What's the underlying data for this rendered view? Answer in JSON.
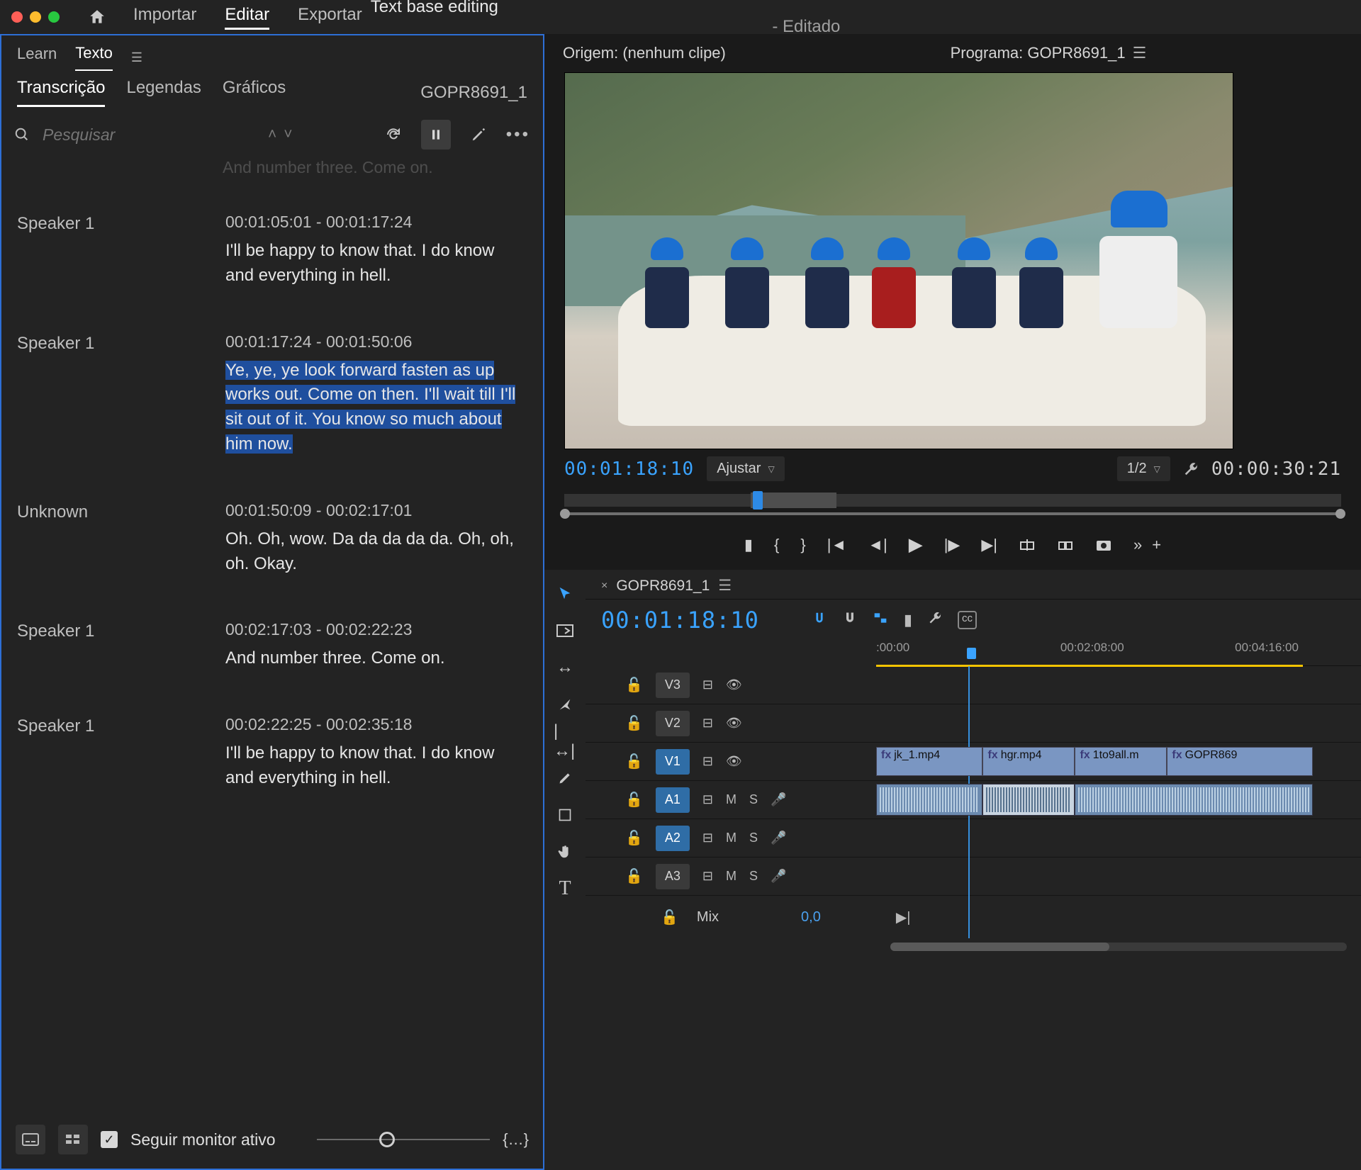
{
  "topbar": {
    "nav": {
      "import": "Importar",
      "edit": "Editar",
      "export": "Exportar"
    },
    "title_main": "Text base editing",
    "title_sub": " - Editado"
  },
  "leftpanel": {
    "tabs1": {
      "learn": "Learn",
      "text": "Texto"
    },
    "tabs2": {
      "transcription": "Transcrição",
      "captions": "Legendas",
      "graphics": "Gráficos"
    },
    "sequence_name": "GOPR8691_1",
    "search_placeholder": "Pesquisar",
    "partial_prev": "And number three. Come on.",
    "entries": [
      {
        "speaker": "Speaker 1",
        "time": "00:01:05:01 - 00:01:17:24",
        "text": "I'll be happy to know that. I do know and everything in hell.",
        "selected": false
      },
      {
        "speaker": "Speaker 1",
        "time": "00:01:17:24 - 00:01:50:06",
        "text": "Ye, ye, ye look forward fasten as up works out. Come on then. I'll wait till I'll sit out of it. You know so much about him now.",
        "selected": true
      },
      {
        "speaker": "Unknown",
        "time": "00:01:50:09 - 00:02:17:01",
        "text": "Oh. Oh, wow. Da da da da da. Oh, oh, oh. Okay.",
        "selected": false
      },
      {
        "speaker": "Speaker 1",
        "time": "00:02:17:03 - 00:02:22:23",
        "text": "And number three. Come on.",
        "selected": false
      },
      {
        "speaker": "Speaker 1",
        "time": "00:02:22:25 - 00:02:35:18",
        "text": "I'll be happy to know that. I do know and everything in hell.",
        "selected": false
      }
    ],
    "bottom": {
      "follow_label": "Seguir monitor ativo"
    }
  },
  "rightpanel": {
    "source_label": "Origem: (nenhum clipe)",
    "program_label": "Programa: GOPR8691_1",
    "monitor": {
      "timecode": "00:01:18:10",
      "fit_label": "Ajustar",
      "zoom_label": "1/2",
      "duration": "00:00:30:21"
    }
  },
  "timeline": {
    "seq_name": "GOPR8691_1",
    "timecode": "00:01:18:10",
    "ruler_ticks": [
      {
        "left": "0%",
        "label": ":00:00"
      },
      {
        "left": "38%",
        "label": "00:02:08:00"
      },
      {
        "left": "74%",
        "label": "00:04:16:00"
      }
    ],
    "v_tracks": [
      {
        "name": "V3",
        "lit": false
      },
      {
        "name": "V2",
        "lit": false
      },
      {
        "name": "V1",
        "lit": true
      }
    ],
    "v1_clips": [
      {
        "left": "0%",
        "width": "22%",
        "label": "jk_1.mp4"
      },
      {
        "left": "22%",
        "width": "19%",
        "label": "hgr.mp4"
      },
      {
        "left": "41%",
        "width": "19%",
        "label": "1to9all.m"
      },
      {
        "left": "60%",
        "width": "30%",
        "label": "GOPR869"
      }
    ],
    "a_tracks": [
      {
        "name": "A1",
        "lit": true
      },
      {
        "name": "A2",
        "lit": true
      },
      {
        "name": "A3",
        "lit": false
      }
    ],
    "a1_clips": [
      {
        "left": "0%",
        "width": "22%",
        "sel": false
      },
      {
        "left": "22%",
        "width": "19%",
        "sel": true
      },
      {
        "left": "41%",
        "width": "49%",
        "sel": false
      }
    ],
    "audio_letters": {
      "m": "M",
      "s": "S"
    },
    "mix": {
      "label": "Mix",
      "value": "0,0"
    }
  }
}
